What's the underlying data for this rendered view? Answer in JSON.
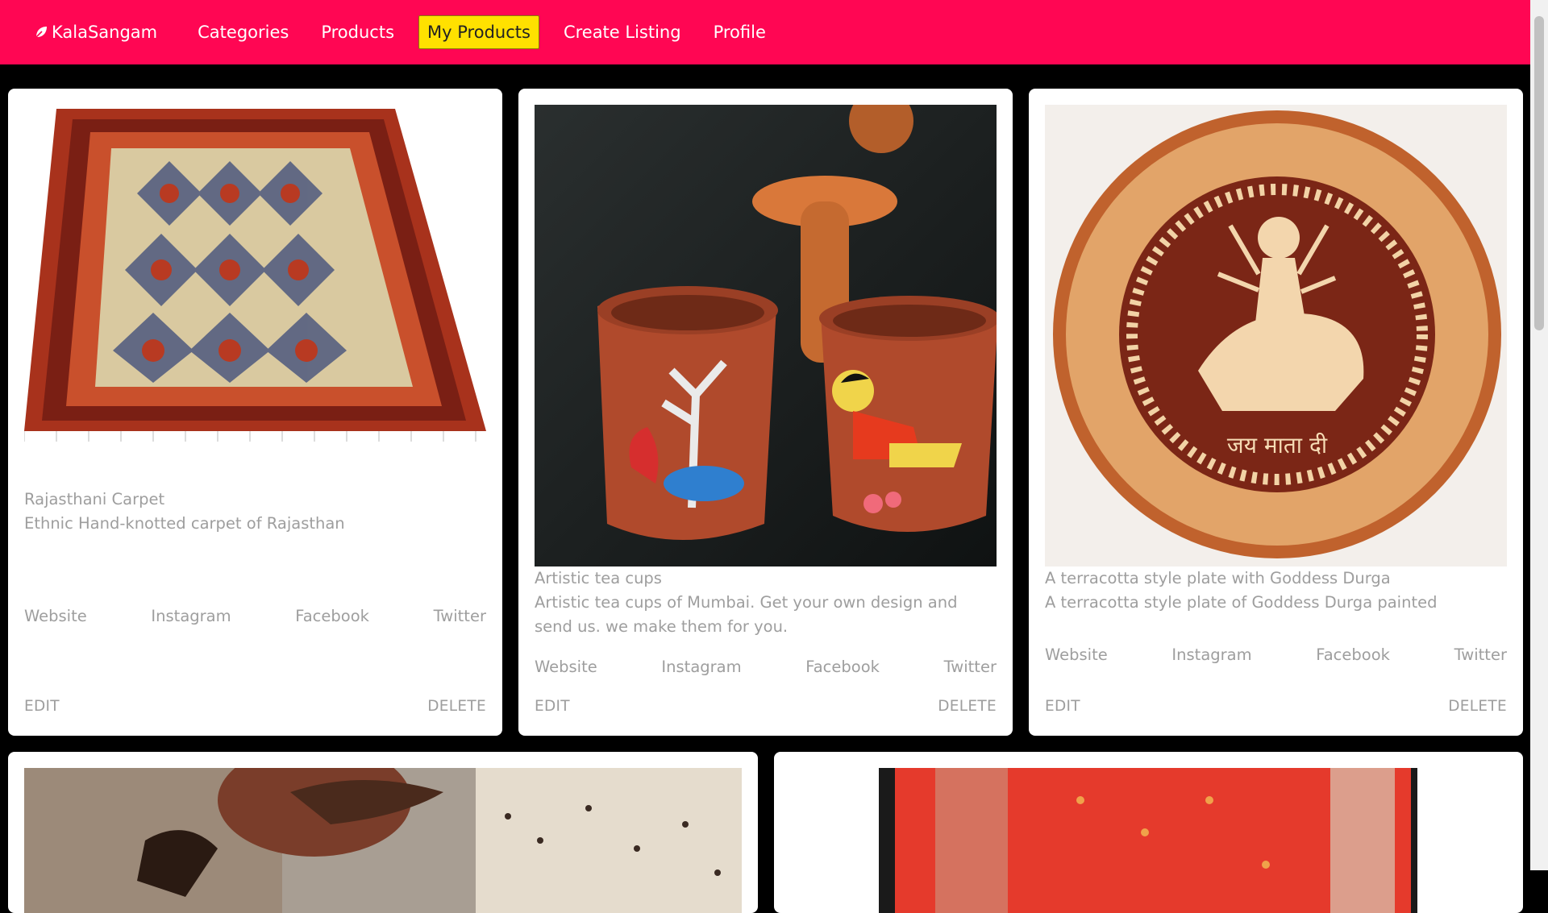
{
  "nav": {
    "brand": "KalaSangam",
    "items": [
      {
        "label": "Categories",
        "active": false
      },
      {
        "label": "Products",
        "active": false
      },
      {
        "label": "My Products",
        "active": true
      },
      {
        "label": "Create Listing",
        "active": false
      },
      {
        "label": "Profile",
        "active": false
      }
    ]
  },
  "colors": {
    "navbar": "#ff0653",
    "active_tab": "#ffe100",
    "page_background": "#000000",
    "card": "#ffffff",
    "muted_text": "#9e9e9e"
  },
  "products": [
    {
      "title": "Rajasthani Carpet",
      "description": "Ethnic Hand-knotted carpet of Rajasthan",
      "image": "carpet-image",
      "links": [
        "Website",
        "Instagram",
        "Facebook",
        "Twitter"
      ],
      "edit": "EDIT",
      "delete": "DELETE"
    },
    {
      "title": "Artistic tea cups",
      "description": "Artistic tea cups of Mumbai. Get your own design and send us. we make them for you.",
      "image": "tea-cups-image",
      "links": [
        "Website",
        "Instagram",
        "Facebook",
        "Twitter"
      ],
      "edit": "EDIT",
      "delete": "DELETE"
    },
    {
      "title": "A terracotta style plate with Goddess Durga",
      "description": "A terracotta style plate of Goddess Durga painted",
      "image": "durga-plate-image",
      "plate_text": "जय माता दी",
      "links": [
        "Website",
        "Instagram",
        "Facebook",
        "Twitter"
      ],
      "edit": "EDIT",
      "delete": "DELETE"
    },
    {
      "image": "artisan-hands-image"
    },
    {
      "image": "red-fabric-image"
    }
  ]
}
